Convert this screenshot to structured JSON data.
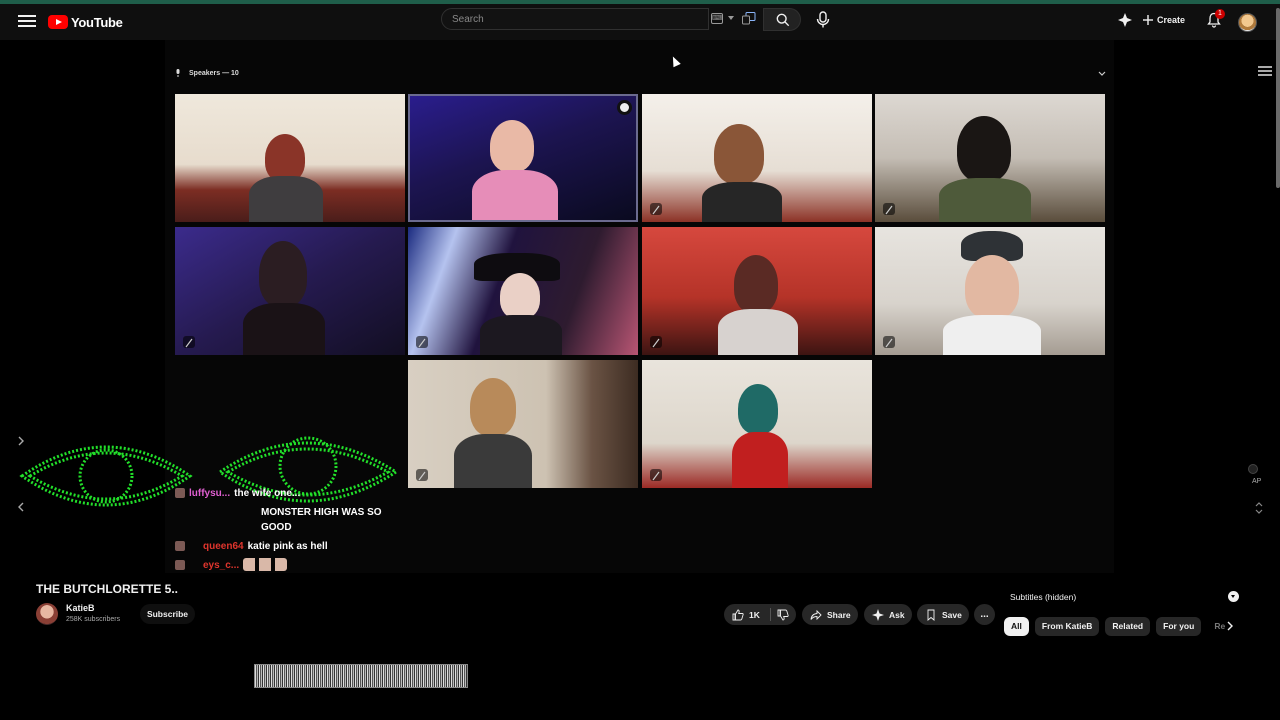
{
  "header": {
    "app_name": "YouTube",
    "search_placeholder": "Search",
    "create_label": "Create",
    "notification_count": "1"
  },
  "player": {
    "speakers_label": "Speakers — 10",
    "chat": [
      {
        "user": "luffysu...",
        "message": "the wife one..."
      },
      {
        "user": "",
        "message": "MONSTER HIGH WAS SO GOOD"
      },
      {
        "user": "queen64",
        "message": "katie pink as hell"
      },
      {
        "user": "eys_c...",
        "message": ""
      }
    ],
    "overlay_label": "AP"
  },
  "video": {
    "title": "THE BUTCHLORETTE 5..",
    "channel": "KatieB",
    "subscribers": "258K subscribers",
    "subscribe_label": "Subscribe",
    "likes": "1K",
    "share_label": "Share",
    "ask_label": "Ask",
    "save_label": "Save",
    "more_label": "..."
  },
  "sidebar": {
    "subtitles_label": "Subtitles (hidden)",
    "chips": [
      "All",
      "From KatieB",
      "Related",
      "For you",
      "Re"
    ]
  },
  "colors": {
    "accent_red": "#ff0000",
    "eye_green": "#22e02a",
    "chat_pink": "#e05fd1",
    "chat_red": "#e0352d"
  }
}
